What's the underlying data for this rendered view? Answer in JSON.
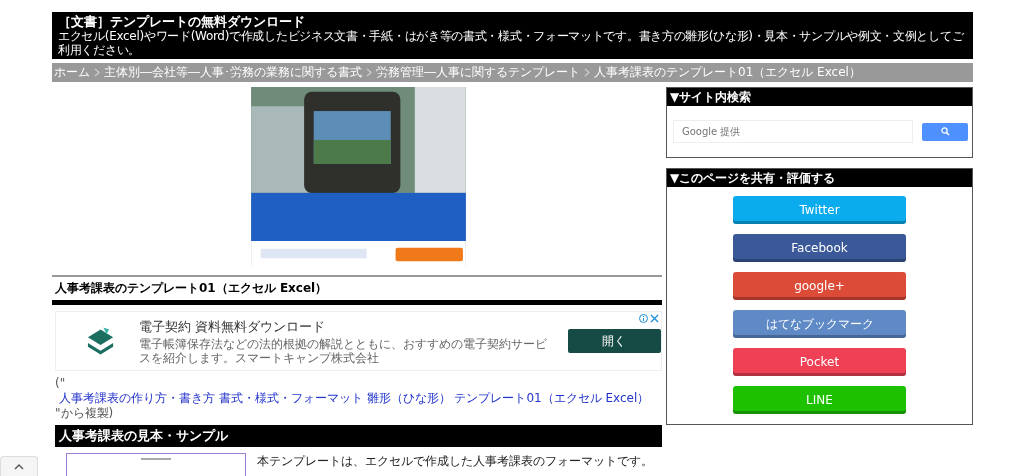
{
  "header": {
    "title": "［文書］テンプレートの無料ダウンロード",
    "subtitle": "エクセル(Excel)やワード(Word)で作成したビジネス文書・手紙・はがき等の書式・様式・フォーマットです。書き方の雛形(ひな形)・見本・サンプルや例文・文例としてご利用ください。"
  },
  "breadcrumb": [
    {
      "label": "ホーム"
    },
    {
      "label": "主体別―会社等―人事･労務の業務に関する書式"
    },
    {
      "label": "労務管理―人事に関するテンプレート"
    },
    {
      "label": "人事考課表のテンプレート01（エクセル Excel）"
    }
  ],
  "page_title": "人事考課表のテンプレート01（エクセル Excel）",
  "text_ad": {
    "title": "電子契約 資料無料ダウンロード",
    "description": "電子帳簿保存法などの法的根拠の解説とともに、おすすめの電子契約サービスを紹介します。スマートキャンプ株式会社",
    "button": "開く"
  },
  "citation": {
    "prefix": "(\"",
    "links": [
      "人事考課表の作り方・書き方 書式・様式・フォーマット 雛形（ひな形） テンプレート01（エクセル Excel）"
    ],
    "suffix": "\"から複製)"
  },
  "section_heading": "人事考課表の見本・サンプル",
  "intro": "本テンプレートは、エクセルで作成した人事考課表のフォーマットです。",
  "sidebar": {
    "search": {
      "heading": "▼サイト内検索",
      "placeholder": "Google 提供"
    },
    "share": {
      "heading": "▼このページを共有・評価する",
      "buttons": [
        {
          "label": "Twitter",
          "color": "#0aaced"
        },
        {
          "label": "Facebook",
          "color": "#3b5998"
        },
        {
          "label": "google+",
          "color": "#dc4a38"
        },
        {
          "label": "はてなブックマーク",
          "color": "#5f8ac6"
        },
        {
          "label": "Pocket",
          "color": "#ef4056"
        },
        {
          "label": "LINE",
          "color": "#1dc100"
        }
      ]
    }
  }
}
